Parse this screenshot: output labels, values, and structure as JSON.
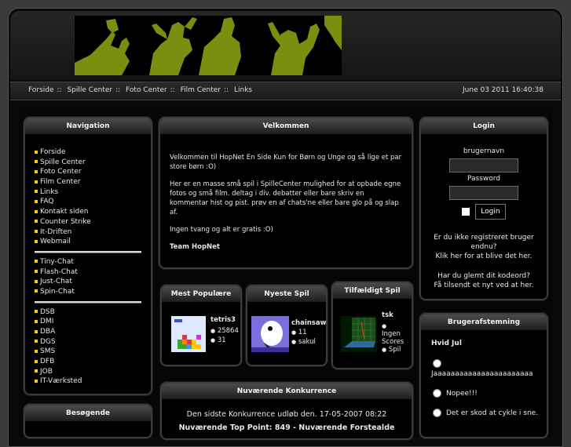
{
  "nav": {
    "links": [
      "Forside",
      "Spille Center",
      "Foto Center",
      "Film Center",
      "Links"
    ],
    "separator": "::",
    "datetime": "June 03 2011 16:40:38"
  },
  "navigation": {
    "title": "Navigation",
    "group1": [
      "Forside",
      "Spille Center",
      "Foto Center",
      "Film Center",
      "Links",
      "FAQ",
      "Kontakt siden",
      "Counter Strike",
      "It-Driften",
      "Webmail"
    ],
    "group2": [
      "Tiny-Chat",
      "Flash-Chat",
      "Just-Chat",
      "Spin-Chat"
    ],
    "group3": [
      "DSB",
      "DMI",
      "DBA",
      "DGS",
      "SMS",
      "DFB",
      "JOB",
      "IT-Værksted"
    ]
  },
  "besogende": {
    "title": "Besøgende"
  },
  "welcome": {
    "title": "Velkommen",
    "p1": "Velkommen til HopNet  En Side Kun for Børn og Unge og så lige et par store børn :O)",
    "p2": "Her er en masse små spil i SpilleCenter mulighed for at opbade egne fotos og små film. deltag i div. debatter eller bare skriv en kommentar hist og pist. prøv en af chats'ne eller bare glo på og slap af.",
    "p3": "Ingen tvang og alt er gratis :O)",
    "p4": "Team HopNet"
  },
  "popular": {
    "title": "Mest Populære",
    "name": "tetris3",
    "line1": "25864",
    "line2": "31"
  },
  "newest": {
    "title": "Nyeste Spil",
    "name": "chainsaw",
    "line1": "11",
    "line2": "sakul"
  },
  "random": {
    "title": "Tilfældigt Spil",
    "name": "tsk",
    "line1": "Ingen",
    "line2": "Scores",
    "line3": "Spil"
  },
  "contest": {
    "title": "Nuværende Konkurrence",
    "text": "Den sidste Konkurrence udløb den. 17-05-2007 08:22",
    "line2": "Nuværende Top Point: 849 - Nuværende Forstealde"
  },
  "login": {
    "title": "Login",
    "username_label": "brugernavn",
    "password_label": "Password",
    "button": "Login",
    "register": "Er du ikke registreret bruger endnu?",
    "register2": "Klik her for at blive det her.",
    "forgot": "Har du glemt dit kodeord?",
    "forgot2": "Få tilsendt et nyt ved at her."
  },
  "poll": {
    "title": "Brugerafstemning",
    "question": "Hvid Jul",
    "options": [
      "Jaaaaaaaaaaaaaaaaaaaaaaa",
      "Nopee!!!",
      "Det er skod at cykle i sne."
    ]
  },
  "colors": {
    "accent": "#ffcc00",
    "banner_green": "#7a8f0f"
  }
}
